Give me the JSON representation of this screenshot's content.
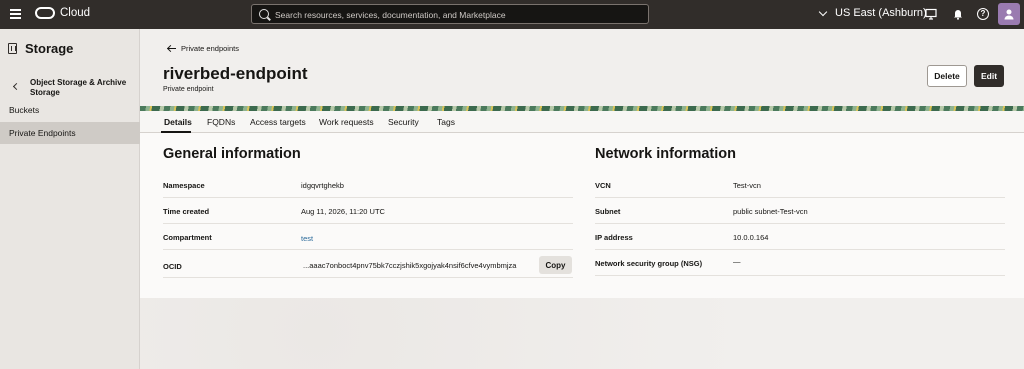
{
  "topbar": {
    "brand": "Cloud",
    "search_placeholder": "Search resources, services, documentation, and Marketplace",
    "region": "US East (Ashburn)",
    "help_glyph": "?"
  },
  "sidebar": {
    "title": "Storage",
    "back_label": "Object Storage & Archive Storage",
    "items": [
      {
        "label": "Buckets"
      },
      {
        "label": "Private Endpoints"
      }
    ]
  },
  "header": {
    "breadcrumb": "Private endpoints",
    "title": "riverbed-endpoint",
    "subtitle": "Private endpoint",
    "delete_label": "Delete",
    "edit_label": "Edit"
  },
  "tabs": [
    "Details",
    "FQDNs",
    "Access targets",
    "Work requests",
    "Security",
    "Tags"
  ],
  "general": {
    "title": "General information",
    "rows": [
      {
        "label": "Namespace",
        "value": "idgqvrtghekb"
      },
      {
        "label": "Time created",
        "value": "Aug 11, 2026, 11:20 UTC"
      },
      {
        "label": "Compartment",
        "value": "test"
      },
      {
        "label": "OCID",
        "value": "...aaac7onboct4pnv75bk7cczjshik5xgojyak4nsif6cfve4vymbmjza"
      }
    ],
    "copy_label": "Copy"
  },
  "network": {
    "title": "Network information",
    "rows": [
      {
        "label": "VCN",
        "value": "Test-vcn"
      },
      {
        "label": "Subnet",
        "value": "public subnet-Test-vcn"
      },
      {
        "label": "IP address",
        "value": "10.0.0.164"
      },
      {
        "label": "Network security group (NSG)",
        "value": "—"
      }
    ]
  },
  "colors": {
    "topbar": "#312d2a",
    "accent_link": "#2b6a9a",
    "avatar": "#9a7bb0"
  }
}
